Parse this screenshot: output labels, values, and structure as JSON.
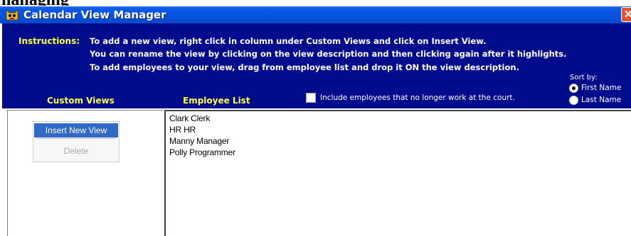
{
  "heading_fragment": "nanaging",
  "window": {
    "title": "Calendar View Manager",
    "close_symbol": "✕"
  },
  "instructions": {
    "label": "Instructions:",
    "lines": [
      "To add a new view, right click in column under Custom Views and click on Insert View.",
      "You can rename the view by clicking on the view description and then clicking again after it highlights.",
      "To add employees to your view, drag from employee list and drop it ON the view description."
    ]
  },
  "headers": {
    "custom_views": "Custom Views",
    "employee_list": "Employee List"
  },
  "include_former": {
    "label": "Include employees that no longer work at the court.",
    "checked": false
  },
  "sort": {
    "label": "Sort by:",
    "options": [
      {
        "label": "First Name",
        "selected": true
      },
      {
        "label": "Last Name",
        "selected": false
      }
    ]
  },
  "employees": [
    "Clark Clerk",
    "HR HR",
    "Manny Manager",
    "Polly Programmer"
  ],
  "context_menu": {
    "items": [
      {
        "label": "Insert New View",
        "highlighted": true,
        "enabled": true
      },
      {
        "label": "Delete",
        "highlighted": false,
        "enabled": false
      }
    ]
  },
  "colors": {
    "title_bar": "#0a52dc",
    "instruction_panel": "#000c8c",
    "label_yellow": "#ffff3a",
    "menu_highlight": "#3169c6",
    "close_button": "#e2562e"
  },
  "icons": {
    "app": "cat-face-icon",
    "close": "close-icon",
    "checkbox": "checkbox-icon",
    "radio": "radio-button-icon"
  }
}
